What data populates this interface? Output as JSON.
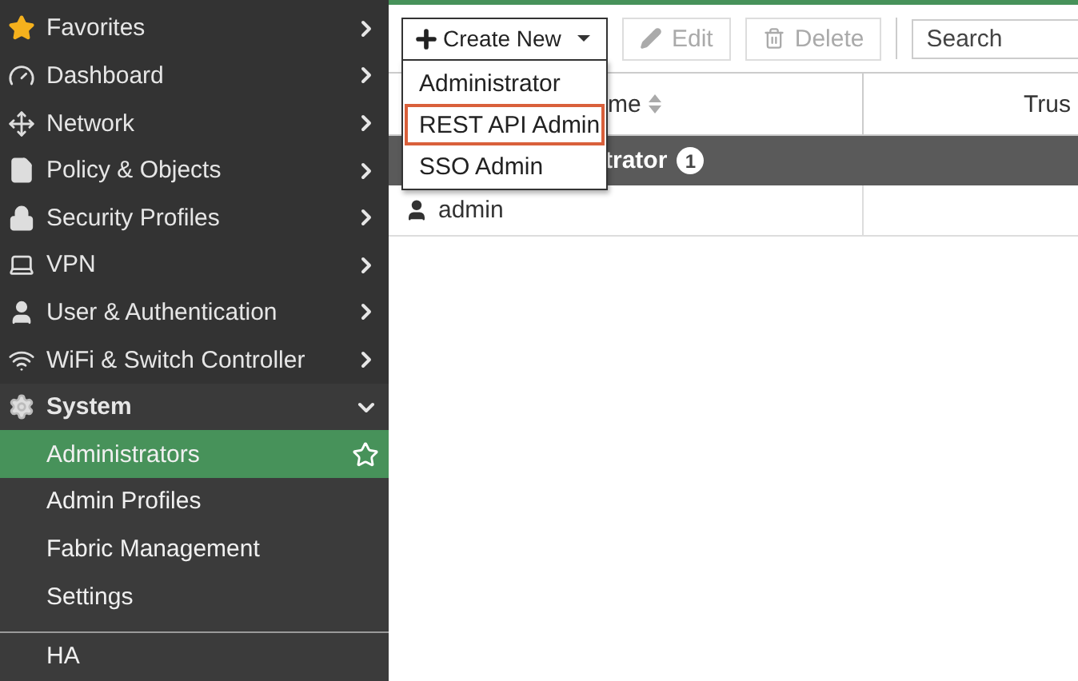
{
  "sidebar": {
    "items": [
      {
        "label": "Favorites",
        "expanded": false
      },
      {
        "label": "Dashboard",
        "expanded": false
      },
      {
        "label": "Network",
        "expanded": false
      },
      {
        "label": "Policy & Objects",
        "expanded": false
      },
      {
        "label": "Security Profiles",
        "expanded": false
      },
      {
        "label": "VPN",
        "expanded": false
      },
      {
        "label": "User & Authentication",
        "expanded": false
      },
      {
        "label": "WiFi & Switch Controller",
        "expanded": false
      },
      {
        "label": "System",
        "expanded": true,
        "children": [
          {
            "label": "Administrators",
            "selected": true
          },
          {
            "label": "Admin Profiles",
            "selected": false
          },
          {
            "label": "Fabric Management",
            "selected": false
          },
          {
            "label": "Settings",
            "selected": false
          }
        ]
      }
    ],
    "footer_items": [
      {
        "label": "HA"
      }
    ]
  },
  "toolbar": {
    "create_button": "Create New",
    "buttons": [
      {
        "label": "Edit",
        "disabled": true
      },
      {
        "label": "Delete",
        "disabled": true
      }
    ],
    "search": {
      "placeholder": "Search"
    }
  },
  "create_menu": [
    {
      "label": "Administrator",
      "selected": false
    },
    {
      "label": "REST API Admin",
      "selected": true
    },
    {
      "label": "SSO Admin",
      "selected": false
    }
  ],
  "table": {
    "columns": [
      {
        "label": "me"
      },
      {
        "label": "Trus"
      }
    ],
    "groups": [
      {
        "label": "trator",
        "count": "1",
        "rows": [
          {
            "cells": [
              "admin"
            ]
          }
        ]
      }
    ]
  }
}
